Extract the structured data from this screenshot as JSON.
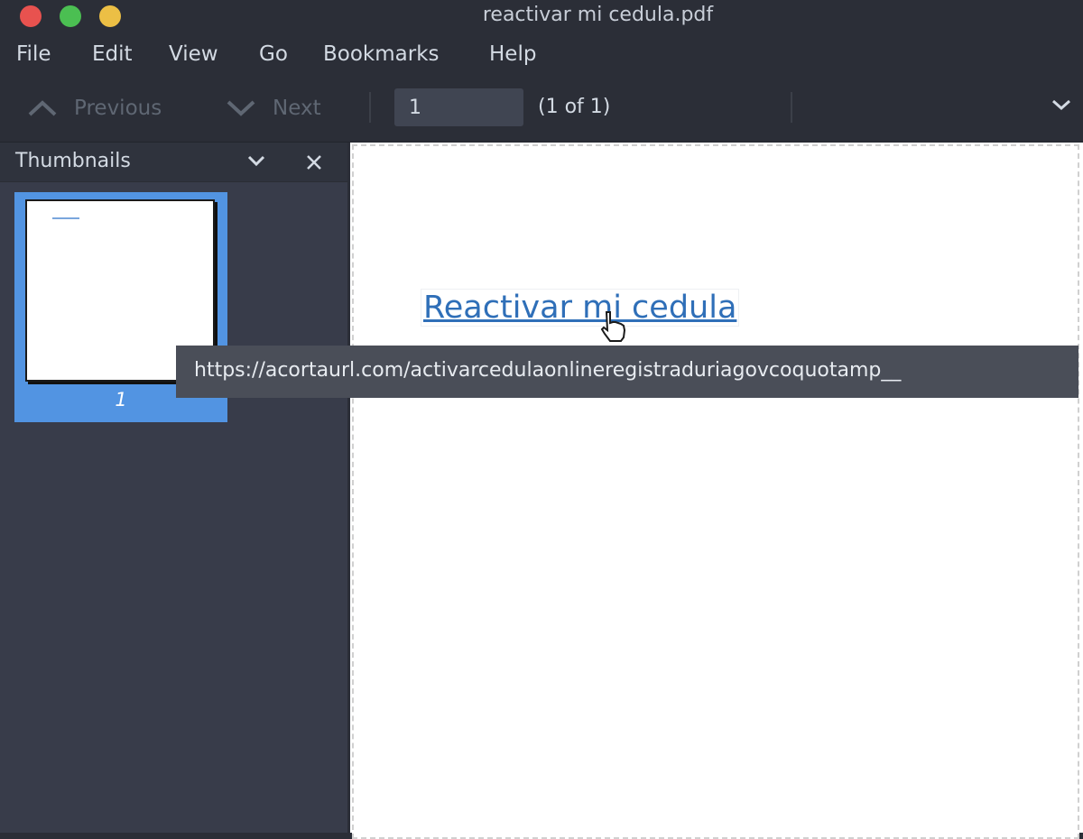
{
  "window": {
    "title": "reactivar mi cedula.pdf",
    "buttons": [
      "close",
      "maximize",
      "minimize"
    ]
  },
  "menubar": {
    "items": [
      "File",
      "Edit",
      "View",
      "Go",
      "Bookmarks",
      "Help"
    ]
  },
  "toolbar": {
    "previous_label": "Previous",
    "next_label": "Next",
    "page_input_value": "1",
    "page_count": "(1 of 1)"
  },
  "sidebar": {
    "title": "Thumbnails",
    "thumbnails": [
      {
        "page_label": "1",
        "selected": true
      }
    ]
  },
  "document": {
    "link_text": "Reactivar mi cedula"
  },
  "tooltip": {
    "text": "https://acortaurl.com/activarcedulaonlineregistraduriagovcoquotamp__"
  },
  "colors": {
    "background": "#2b2e37",
    "sidebar": "#383c4a",
    "selection": "#5294e2",
    "link": "#2f6fb8"
  }
}
